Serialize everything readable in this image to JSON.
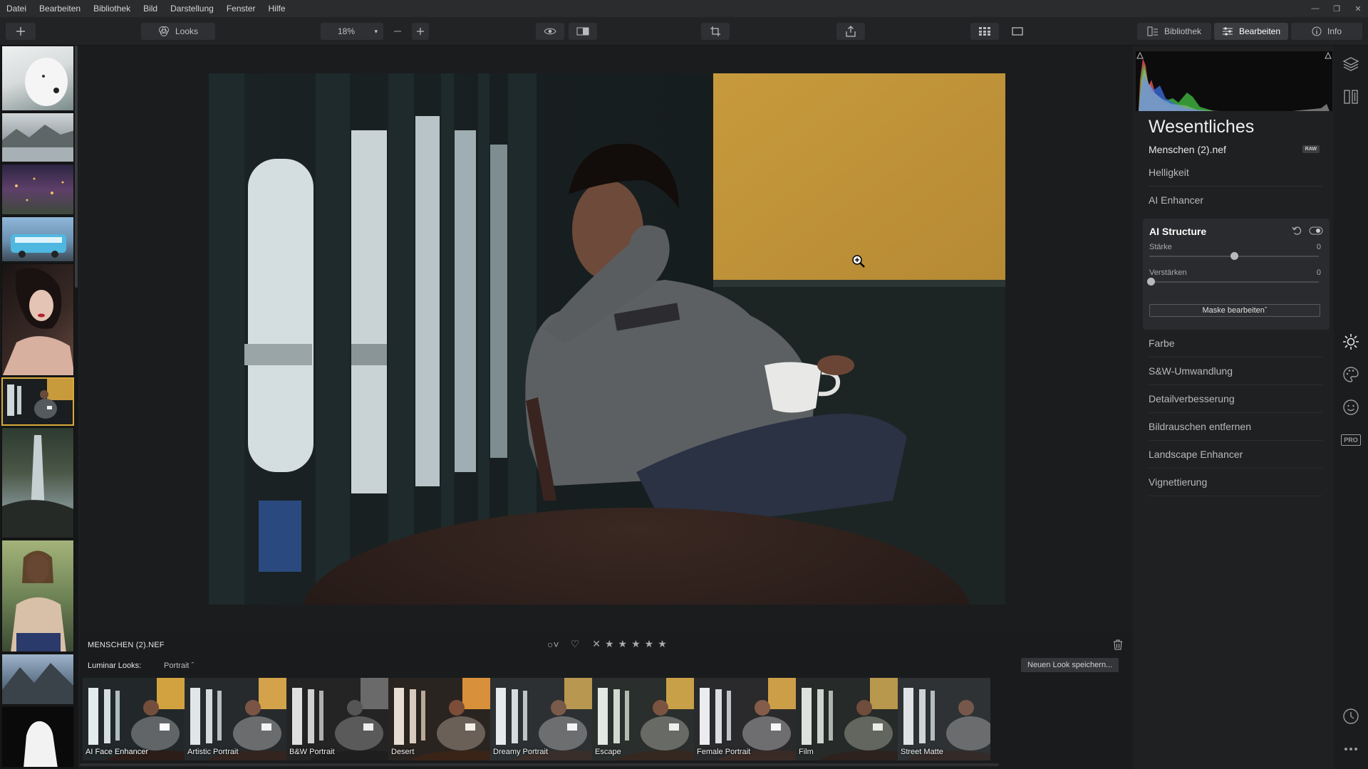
{
  "menu": [
    "Datei",
    "Bearbeiten",
    "Bibliothek",
    "Bild",
    "Darstellung",
    "Fenster",
    "Hilfe"
  ],
  "toolbar": {
    "looks_label": "Looks",
    "zoom": "18%",
    "tab_library": "Bibliothek",
    "tab_edit": "Bearbeiten",
    "tab_info": "Info"
  },
  "canvas": {
    "filename": "MENSCHEN (2).NEF"
  },
  "looks": {
    "label": "Luminar Looks:",
    "category": "Portrait",
    "save_button": "Neuen Look speichern...",
    "items": [
      "AI Face Enhancer",
      "Artistic Portrait",
      "B&W Portrait",
      "Desert",
      "Dreamy Portrait",
      "Escape",
      "Female Portrait",
      "Film",
      "Street Matte"
    ]
  },
  "panel": {
    "title": "Wesentliches",
    "file": "Menschen (2).nef",
    "raw_badge": "RAW",
    "sections_top": [
      "Helligkeit",
      "AI Enhancer"
    ],
    "ai_structure": {
      "title": "AI Structure",
      "sliders": [
        {
          "label": "Stärke",
          "value": "0"
        },
        {
          "label": "Verstärken",
          "value": "0"
        }
      ],
      "mask_button": "Maske bearbeiten"
    },
    "sections_bottom": [
      "Farbe",
      "S&W-Umwandlung",
      "Detailverbesserung",
      "Bildrauschen entfernen",
      "Landscape Enhancer",
      "Vignettierung"
    ]
  },
  "side_icons": {
    "pro_label": "PRO"
  },
  "colors": {
    "accent_selected": "#d9a93a",
    "panel_bg": "#1f2022"
  }
}
